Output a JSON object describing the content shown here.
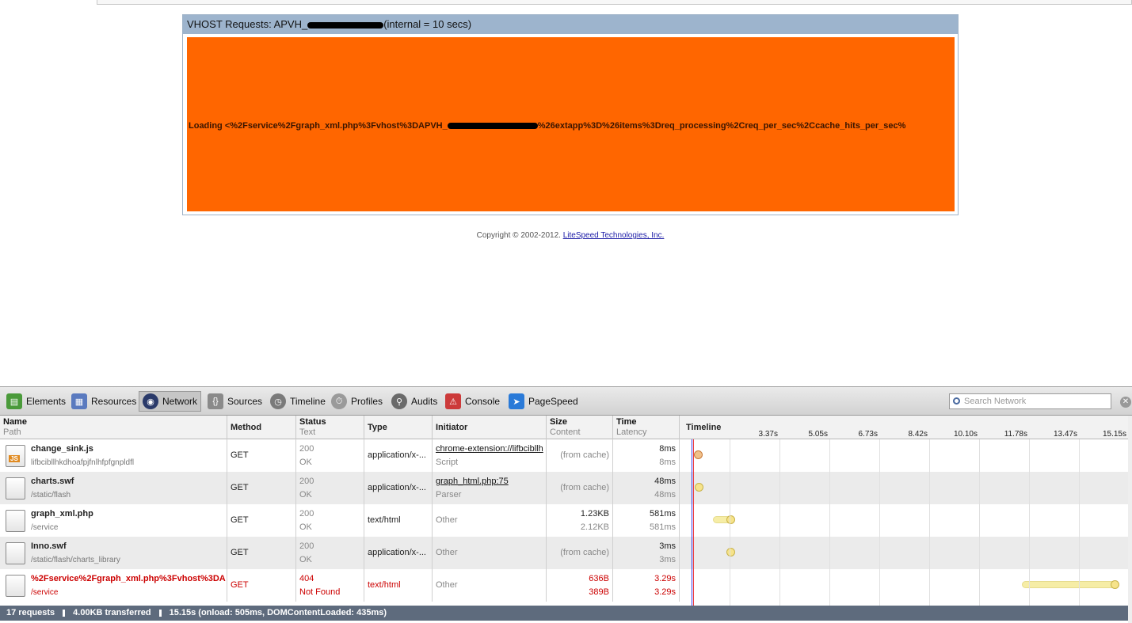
{
  "page": {
    "vhost_title_prefix": "VHOST Requests: APVH_",
    "vhost_title_suffix": "(internal = 10 secs)",
    "loading_prefix": "Loading <%2Fservice%2Fgraph_xml.php%3Fvhost%3DAPVH_",
    "loading_suffix": "%26extapp%3D%26items%3Dreq_processing%2Creq_per_sec%2Ccache_hits_per_sec%",
    "copyright_text": "Copyright © 2002-2012.",
    "copyright_link": "LiteSpeed Technologies, Inc.",
    "colors": {
      "loading_bg": "#ff6600",
      "header_bg": "#9db4cd"
    }
  },
  "devtools": {
    "tabs": [
      {
        "label": "Elements",
        "icon": "elements-icon"
      },
      {
        "label": "Resources",
        "icon": "resources-icon"
      },
      {
        "label": "Network",
        "icon": "network-icon",
        "active": true
      },
      {
        "label": "Sources",
        "icon": "sources-icon"
      },
      {
        "label": "Timeline",
        "icon": "timeline-icon"
      },
      {
        "label": "Profiles",
        "icon": "profiles-icon"
      },
      {
        "label": "Audits",
        "icon": "audits-icon"
      },
      {
        "label": "Console",
        "icon": "console-icon"
      },
      {
        "label": "PageSpeed",
        "icon": "pagespeed-icon"
      }
    ],
    "search_placeholder": "Search Network"
  },
  "network": {
    "headers": {
      "name": "Name",
      "path": "Path",
      "method": "Method",
      "status": "Status",
      "status_text": "Text",
      "type": "Type",
      "initiator": "Initiator",
      "size": "Size",
      "content": "Content",
      "time": "Time",
      "latency": "Latency",
      "timeline": "Timeline"
    },
    "ticks": [
      "3.37s",
      "5.05s",
      "6.73s",
      "8.42s",
      "10.10s",
      "11.78s",
      "13.47s",
      "15.15s"
    ],
    "rows": [
      {
        "name": "change_sink.js",
        "path": "lifbcibllhkdhoafpjfnlhfpfgnpldfl",
        "method": "GET",
        "status": "200",
        "status_text": "OK",
        "type": "application/x-...",
        "initiator": "chrome-extension://lifbcibllh",
        "initiator_sub": "Script",
        "size": "(from cache)",
        "content": "",
        "time": "8ms",
        "latency": "8ms",
        "error": false,
        "js": true
      },
      {
        "name": "charts.swf",
        "path": "/static/flash",
        "method": "GET",
        "status": "200",
        "status_text": "OK",
        "type": "application/x-...",
        "initiator": "graph_html.php:75",
        "initiator_sub": "Parser",
        "size": "(from cache)",
        "content": "",
        "time": "48ms",
        "latency": "48ms",
        "error": false,
        "js": false
      },
      {
        "name": "graph_xml.php",
        "path": "/service",
        "method": "GET",
        "status": "200",
        "status_text": "OK",
        "type": "text/html",
        "initiator": "Other",
        "initiator_sub": "",
        "size": "1.23KB",
        "content": "2.12KB",
        "time": "581ms",
        "latency": "581ms",
        "error": false,
        "js": false
      },
      {
        "name": "Inno.swf",
        "path": "/static/flash/charts_library",
        "method": "GET",
        "status": "200",
        "status_text": "OK",
        "type": "application/x-...",
        "initiator": "Other",
        "initiator_sub": "",
        "size": "(from cache)",
        "content": "",
        "time": "3ms",
        "latency": "3ms",
        "error": false,
        "js": false
      },
      {
        "name": "%2Fservice%2Fgraph_xml.php%3Fvhost%3DA",
        "path": "/service",
        "method": "GET",
        "status": "404",
        "status_text": "Not Found",
        "type": "text/html",
        "initiator": "Other",
        "initiator_sub": "",
        "size": "636B",
        "content": "389B",
        "time": "3.29s",
        "latency": "3.29s",
        "error": true,
        "js": false
      }
    ],
    "summary": {
      "requests": "17 requests",
      "transferred": "4.00KB transferred",
      "timing": "15.15s (onload: 505ms, DOMContentLoaded: 435ms)"
    }
  }
}
